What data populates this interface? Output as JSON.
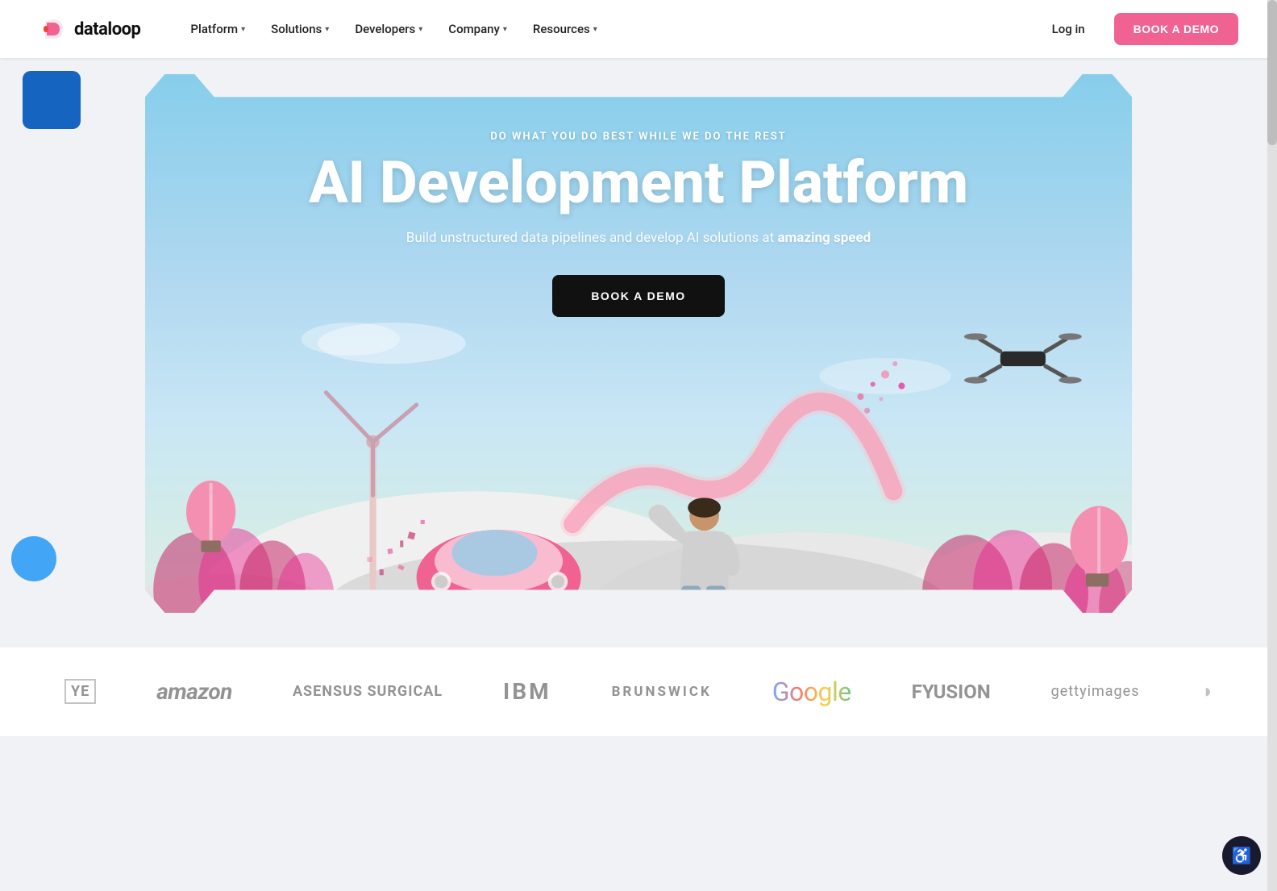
{
  "navbar": {
    "logo_text": "dataloop",
    "nav_items": [
      {
        "id": "platform",
        "label": "Platform"
      },
      {
        "id": "solutions",
        "label": "Solutions"
      },
      {
        "id": "developers",
        "label": "Developers"
      },
      {
        "id": "company",
        "label": "Company"
      },
      {
        "id": "resources",
        "label": "Resources"
      }
    ],
    "login_label": "Log in",
    "book_demo_label": "BOOK A DEMO"
  },
  "hero": {
    "subtitle": "DO WHAT YOU DO BEST WHILE WE DO THE REST",
    "title": "AI Development Platform",
    "description_start": "Build unstructured data pipelines and develop AI solutions at ",
    "description_highlight": "amazing speed",
    "cta_label": "BOOK A DEMO"
  },
  "logos": {
    "companies": [
      {
        "id": "ye",
        "label": "YE"
      },
      {
        "id": "amazon",
        "label": "amazon"
      },
      {
        "id": "asensus",
        "label": "ASENSUS SURGICAL"
      },
      {
        "id": "ibm",
        "label": "IBM"
      },
      {
        "id": "brunswick",
        "label": "BRUNSWICK"
      },
      {
        "id": "google",
        "label": "Google"
      },
      {
        "id": "fyusion",
        "label": "FYUSION"
      },
      {
        "id": "gettyimages",
        "label": "gettyimages"
      }
    ]
  },
  "colors": {
    "primary_pink": "#f06292",
    "primary_blue": "#1565c0",
    "sky_blue": "#87ceeb",
    "dark": "#111111"
  }
}
